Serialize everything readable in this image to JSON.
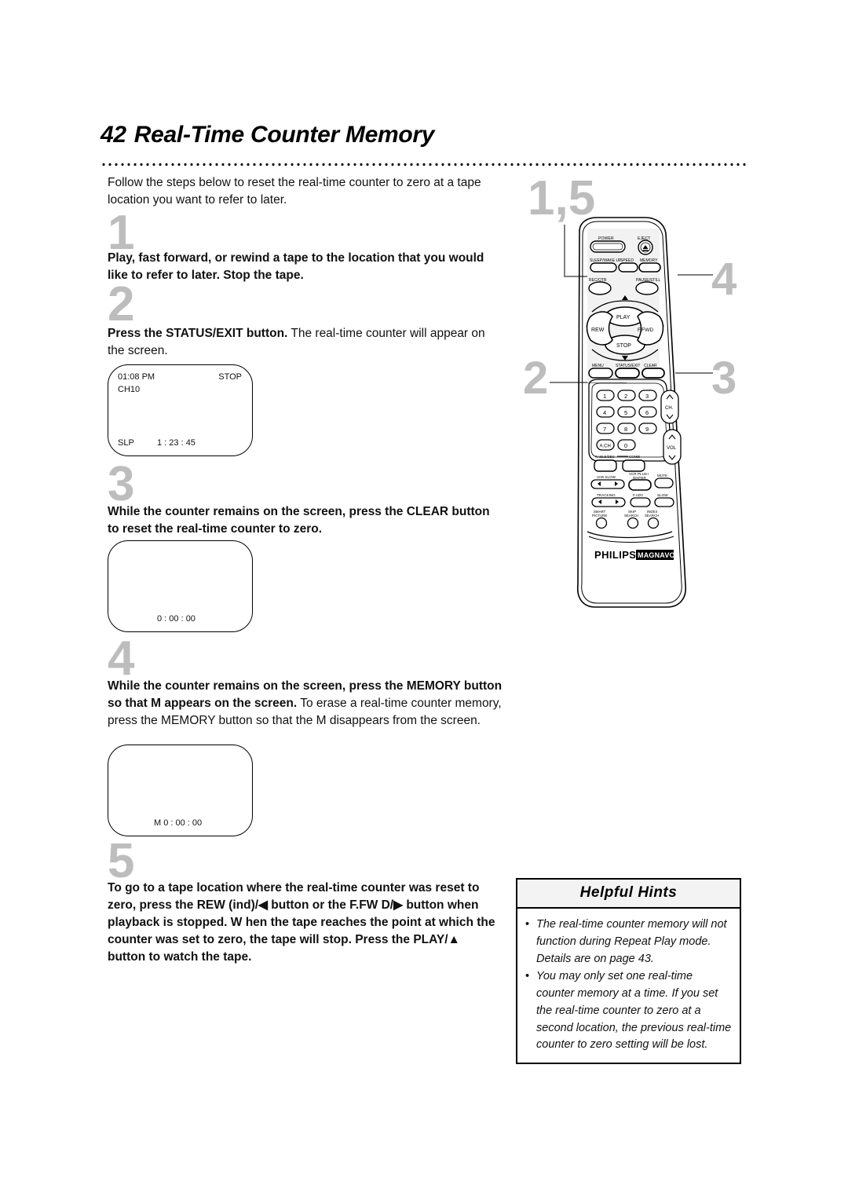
{
  "header": {
    "page_number": "42",
    "title": "Real-Time Counter Memory"
  },
  "intro": "Follow the steps below to reset the real-time counter to zero at a tape location you want to refer to later.",
  "steps": [
    {
      "number": "1",
      "bold": "Play, fast forward, or rewind a tape to the location that you would like to refer to later.  Stop the tape.",
      "rest": ""
    },
    {
      "number": "2",
      "bold": "Press the STATUS/EXIT button.",
      "rest": " The real-time counter will appear on the screen."
    },
    {
      "number": "3",
      "bold": "While the counter remains on the screen, press the CLEAR button to reset the real-time counter to zero.",
      "rest": ""
    },
    {
      "number": "4",
      "bold": "While the counter remains on the screen, press the MEMORY button so that M appears on the screen.",
      "rest": " To erase a real-time counter memory, press the MEMORY button so that the M disappears from the screen."
    },
    {
      "number": "5",
      "bold": "To go to a tape location where the real-time counter was reset to zero, press the REW (ind)/◀ button or the F.FW D/▶ button when playback is stopped. W hen the tape reaches the point at which the counter was set to zero, the tape will stop. Press the PLAY/▲ button to watch the tape.",
      "rest": ""
    }
  ],
  "screens": [
    {
      "id": "screen-status",
      "time": "01:08 PM",
      "mode": "STOP",
      "channel": "CH10",
      "speed": "SLP",
      "counter": "1 : 23 : 45"
    },
    {
      "id": "screen-cleared",
      "counter": "0 : 00 : 00"
    },
    {
      "id": "screen-memory",
      "counter": "M  0 : 00 : 00"
    }
  ],
  "hints": {
    "heading": "Helpful Hints",
    "bullet": "•",
    "items": [
      "The real-time counter memory will not function during Repeat Play mode.  Details are on page 43.",
      "You may only set one real-time counter memory at a time. If you set the real-time counter to zero at a second location, the previous real-time counter to zero setting will be lost."
    ]
  },
  "callouts": [
    {
      "id": "callout-1-5",
      "label": "1,5"
    },
    {
      "id": "callout-4",
      "label": "4"
    },
    {
      "id": "callout-3",
      "label": "3"
    },
    {
      "id": "callout-2",
      "label": "2"
    }
  ],
  "remote": {
    "brand": "PHILIPS",
    "sub_brand": "MAGNAVOX",
    "buttons": {
      "power": "POWER",
      "eject": "EJECT",
      "sleep_wake": "SLEEP/WAKE UP",
      "speed": "SPEED",
      "memory": "MEMORY",
      "rec_otr": "REC/OTR",
      "pause_still": "PAUSE/STILL",
      "play": "PLAY",
      "rew": "REW",
      "ffwd": "F.FWD",
      "stop": "STOP",
      "menu": "MENU",
      "status_exit": "STATUS/EXIT",
      "clear": "CLEAR",
      "ch": "CH.",
      "vol": "VOL",
      "a_ch": "A.CH",
      "cable_dbs": "CABLE/DBS",
      "combi": "COMBI",
      "var_slow": "VAR.SLOW",
      "vcr_plus_enter": "VCR PLUS+ /ENTER",
      "mute": "MUTE",
      "tracking": "TRACKING",
      "f_adv": "F.ADV",
      "slow": "SLOW",
      "smart_picture": "SMART PICTURE",
      "skip_search": "SKIP SEARCH",
      "index_search": "INDEX SEARCH"
    },
    "keypad": [
      "1",
      "2",
      "3",
      "4",
      "5",
      "6",
      "7",
      "8",
      "9",
      "0"
    ]
  },
  "colors": {
    "step_number_gray": "#bdbdbd",
    "callout_gray": "#bdbdbd",
    "text_black": "#111111",
    "hint_header_bg": "#f3f3f3"
  }
}
